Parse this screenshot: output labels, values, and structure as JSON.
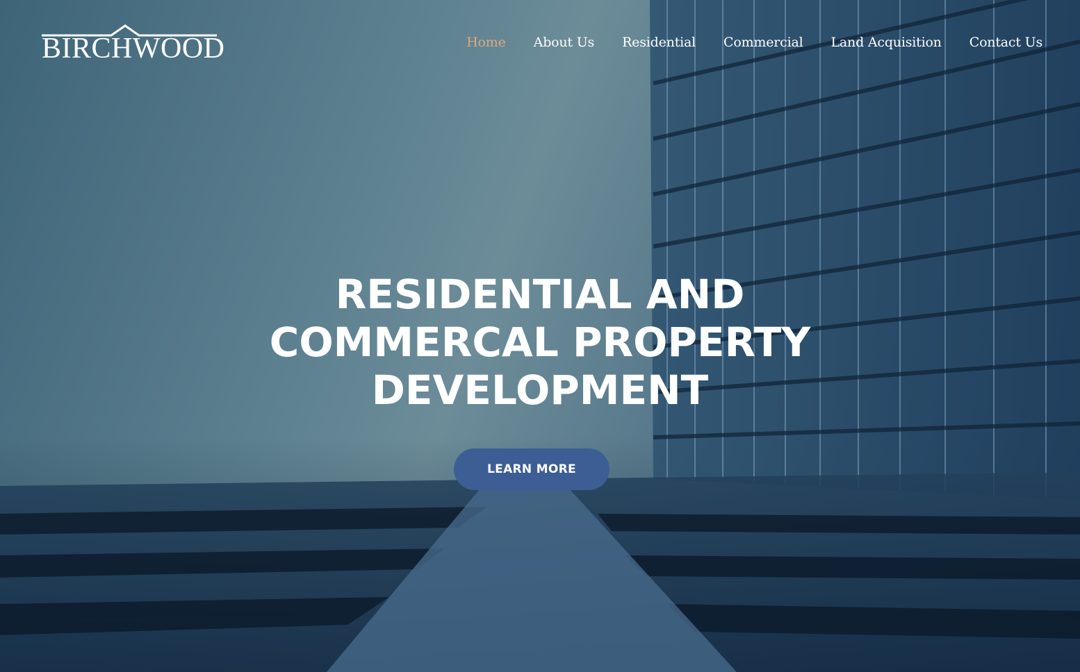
{
  "brand": {
    "name": "BIRCHWOOD",
    "accent_color": "#d9a982",
    "button_color": "#3c5e95",
    "logo_icon": "roof-icon"
  },
  "nav": {
    "items": [
      {
        "label": "Home",
        "active": true
      },
      {
        "label": "About Us",
        "active": false
      },
      {
        "label": "Residential",
        "active": false
      },
      {
        "label": "Commercial",
        "active": false
      },
      {
        "label": "Land Acquisition",
        "active": false
      },
      {
        "label": "Contact Us",
        "active": false
      }
    ]
  },
  "hero": {
    "headline_lines": [
      "RESIDENTIAL AND",
      "COMMERCAL PROPERTY",
      "DEVELOPMENT"
    ],
    "cta_label": "LEARN MORE"
  }
}
